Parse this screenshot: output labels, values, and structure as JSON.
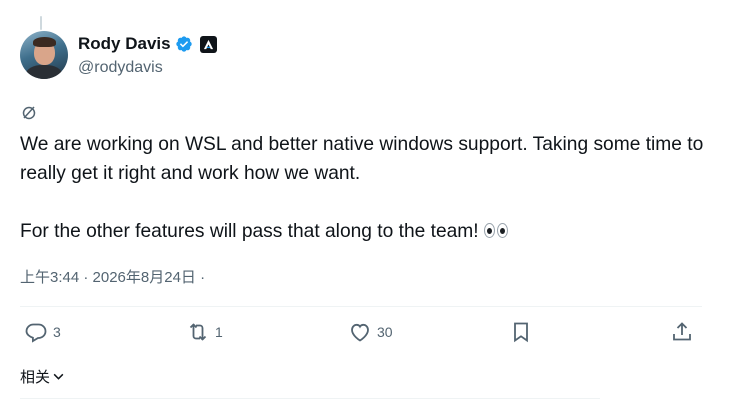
{
  "author": {
    "display_name": "Rody Davis",
    "handle": "@rodydavis",
    "verified_icon": "verified-badge-icon",
    "affiliate_icon": "affiliate-badge-icon"
  },
  "tweet": {
    "paragraph_1": "We are working on WSL and better native windows support. Taking some time to really get it right and work how we want.",
    "paragraph_2": "For the other features will pass that along to the team!",
    "timestamp": "上午3:44 · 2026年8月24日 ·"
  },
  "actions": {
    "reply_count": "3",
    "retweet_count": "1",
    "like_count": "30"
  },
  "related_label": "相关",
  "colors": {
    "text": "#0f1419",
    "muted": "#536471",
    "verified": "#1d9bf0",
    "divider": "#eff3f4"
  }
}
